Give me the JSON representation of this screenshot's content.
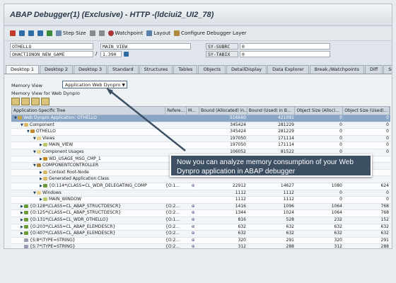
{
  "window": {
    "title": "ABAP Debugger(1)  (Exclusive) - HTTP -(ldciui2_UI2_78)"
  },
  "toolbar": {
    "step_size": "Step Size",
    "watchpoint": "Watchpoint",
    "layout": "Layout",
    "configure": "Configure Debugger Layer"
  },
  "fields": {
    "program": "OTHELLO",
    "include": "OHACTIONON_NEW_GAME",
    "main_view": "MAIN_VIEW",
    "line_sep": "/",
    "line_no": "1.390",
    "sy_subrc_label": "SY-SUBRC",
    "sy_subrc": "0",
    "sy_tabix_label": "SY-TABIX",
    "sy_tabix": "0"
  },
  "tabs": [
    "Desktop 1",
    "Desktop 2",
    "Desktop 3",
    "Standard",
    "Structures",
    "Tables",
    "Objects",
    "DetailDisplay",
    "Data Explorer",
    "Break./Watchpoints",
    "Diff",
    "Script"
  ],
  "memory_view": {
    "label": "Memory View",
    "value": "Application Web Dynpro",
    "for_label": "Memory View for Web Dynpro"
  },
  "grid": {
    "headers": [
      "Application-Specific Tree",
      "Refere...",
      "M...",
      "Bound (Allocated) in...",
      "Bound (Used) in B...",
      "Object Size (Alloc)...",
      "Object Size (Used)..."
    ],
    "rows": [
      {
        "name": "Web Dynpro Application: OTHELLO",
        "ref": "",
        "m": "",
        "ba": "516660",
        "bu": "421091",
        "oa": "0",
        "ou": "0",
        "sel": true,
        "indent": 0,
        "exp": "▼",
        "ico": "#c9a24a"
      },
      {
        "name": "Component",
        "ref": "",
        "m": "",
        "ba": "345424",
        "bu": "281229",
        "oa": "0",
        "ou": "0",
        "indent": 1,
        "exp": "▼",
        "ico": "#d9b866"
      },
      {
        "name": "OTHELLO",
        "ref": "",
        "m": "",
        "ba": "345424",
        "bu": "281229",
        "oa": "0",
        "ou": "0",
        "indent": 2,
        "exp": "▼",
        "ico": "#c48a2a"
      },
      {
        "name": "Views",
        "ref": "",
        "m": "",
        "ba": "197050",
        "bu": "171114",
        "oa": "0",
        "ou": "0",
        "indent": 3,
        "exp": "▼",
        "ico": "#e6d28c"
      },
      {
        "name": "MAIN_VIEW",
        "ref": "",
        "m": "",
        "ba": "197050",
        "bu": "171114",
        "oa": "0",
        "ou": "0",
        "indent": 4,
        "exp": "▶",
        "ico": "#b9c86a"
      },
      {
        "name": "Component Usages",
        "ref": "",
        "m": "",
        "ba": "106052",
        "bu": "81522",
        "oa": "0",
        "ou": "0",
        "indent": 3,
        "exp": "▼",
        "ico": "#e6d28c"
      },
      {
        "name": "WD_USAGE_MSG_CMP_1",
        "ref": "",
        "m": "",
        "ba": "",
        "bu": "",
        "oa": "",
        "ou": "",
        "indent": 4,
        "exp": "▶",
        "ico": "#c48a2a"
      },
      {
        "name": "COMPONENTCONTROLLER",
        "ref": "",
        "m": "",
        "ba": "",
        "bu": "",
        "oa": "",
        "ou": "",
        "indent": 3,
        "exp": "▼",
        "ico": "#b08a3a"
      },
      {
        "name": "Context Root-Node",
        "ref": "",
        "m": "",
        "ba": "",
        "bu": "",
        "oa": "",
        "ou": "",
        "indent": 4,
        "exp": "▶",
        "ico": "#d9b866"
      },
      {
        "name": "Generated Application Class",
        "ref": "",
        "m": "",
        "ba": "",
        "bu": "",
        "oa": "",
        "ou": "",
        "indent": 4,
        "exp": "▶",
        "ico": "#d9b866"
      },
      {
        "name": "{O:114*\\CLASS=CL_WDR_DELEGATING_COMP",
        "ref": "{O:1...",
        "m": "⊕",
        "ba": "22912",
        "bu": "14627",
        "oa": "1080",
        "ou": "624",
        "indent": 4,
        "exp": "▶",
        "ico": "#6a9a3a"
      },
      {
        "name": "Windows",
        "ref": "",
        "m": "",
        "ba": "1112",
        "bu": "1112",
        "oa": "0",
        "ou": "0",
        "indent": 3,
        "exp": "▼",
        "ico": "#e6d28c"
      },
      {
        "name": "MAIN_WINDOW",
        "ref": "",
        "m": "",
        "ba": "1112",
        "bu": "1112",
        "oa": "0",
        "ou": "0",
        "indent": 4,
        "exp": "▶",
        "ico": "#b9c86a"
      },
      {
        "name": "{O:128*\\CLASS=CL_ABAP_STRUCTDESCR}",
        "ref": "{O:2...",
        "m": "⊕",
        "ba": "1416",
        "bu": "1096",
        "oa": "1064",
        "ou": "768",
        "indent": 1,
        "exp": "▶",
        "ico": "#6a9a3a"
      },
      {
        "name": "{O:125*\\CLASS=CL_ABAP_STRUCTDESCR}",
        "ref": "{O:2...",
        "m": "⊕",
        "ba": "1344",
        "bu": "1024",
        "oa": "1064",
        "ou": "768",
        "indent": 1,
        "exp": "▶",
        "ico": "#6a9a3a"
      },
      {
        "name": "{O:131*\\CLASS=CL_WDR_OTHELLO}",
        "ref": "{O:1...",
        "m": "⊕",
        "ba": "816",
        "bu": "528",
        "oa": "232",
        "ou": "152",
        "indent": 1,
        "exp": "▶",
        "ico": "#6a9a3a"
      },
      {
        "name": "{O:203*\\CLASS=CL_ABAP_ELEMDESCR}",
        "ref": "{O:2...",
        "m": "⊕",
        "ba": "632",
        "bu": "632",
        "oa": "632",
        "ou": "632",
        "indent": 1,
        "exp": "▶",
        "ico": "#6a9a3a"
      },
      {
        "name": "{O:407*\\CLASS=CL_ABAP_ELEMDESCR}",
        "ref": "{O:2...",
        "m": "⊕",
        "ba": "632",
        "bu": "632",
        "oa": "632",
        "ou": "632",
        "indent": 1,
        "exp": "▶",
        "ico": "#6a9a3a"
      },
      {
        "name": "{S:8*\\TYPE=STRING}",
        "ref": "{O:2...",
        "m": "⊕",
        "ba": "320",
        "bu": "291",
        "oa": "320",
        "ou": "291",
        "indent": 1,
        "exp": "",
        "ico": "#9a9ab0"
      },
      {
        "name": "{S:7*\\TYPE=STRING}",
        "ref": "{O:2...",
        "m": "⊕",
        "ba": "312",
        "bu": "288",
        "oa": "312",
        "ou": "288",
        "indent": 1,
        "exp": "",
        "ico": "#9a9ab0"
      }
    ]
  },
  "callout": {
    "text": "Now you can analyze memory consumption of your Web Dynpro application in ABAP debugger"
  }
}
